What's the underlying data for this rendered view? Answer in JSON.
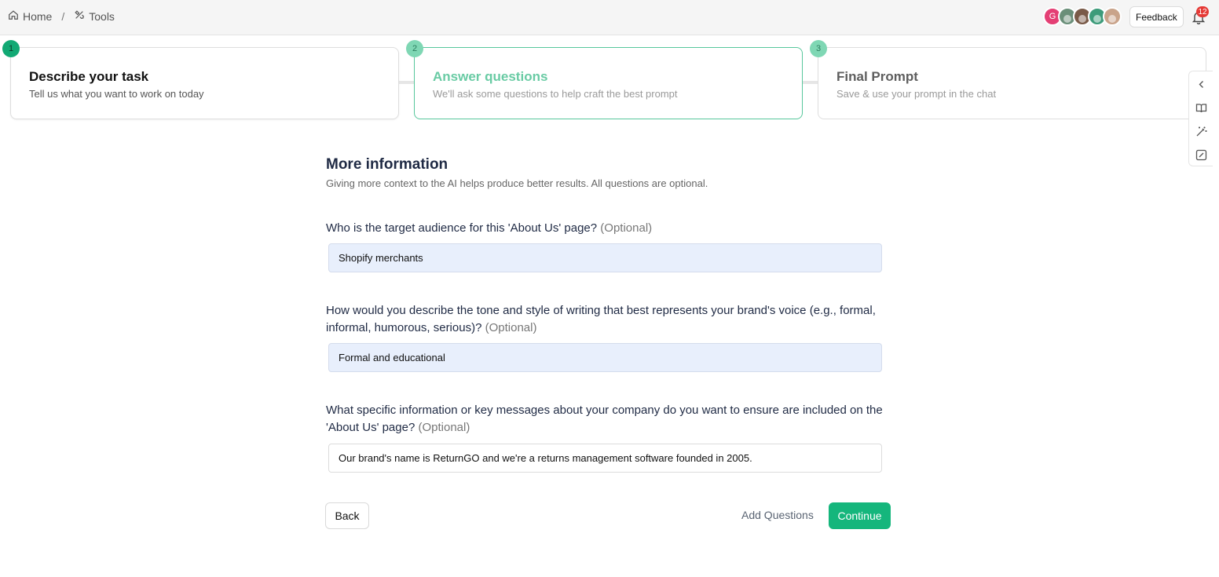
{
  "breadcrumb": {
    "home_label": "Home",
    "separator": "/",
    "tools_label": "Tools"
  },
  "header": {
    "avatars": [
      "G"
    ],
    "feedback_label": "Feedback",
    "notification_count": "12"
  },
  "steps": [
    {
      "number": "1",
      "title": "Describe your task",
      "subtitle": "Tell us what you want to work on today"
    },
    {
      "number": "2",
      "title": "Answer questions",
      "subtitle": "We'll ask some questions to help craft the best prompt"
    },
    {
      "number": "3",
      "title": "Final Prompt",
      "subtitle": "Save & use your prompt in the chat"
    }
  ],
  "form": {
    "title": "More information",
    "subtitle": "Giving more context to the AI helps produce better results. All questions are optional.",
    "optional_label": "(Optional)",
    "questions": [
      {
        "label": "Who is the target audience for this 'About Us' page?",
        "value": "Shopify merchants"
      },
      {
        "label": "How would you describe the tone and style of writing that best represents your brand's voice (e.g., formal, informal, humorous, serious)?",
        "value": "Formal and educational"
      },
      {
        "label": "What specific information or key messages about your company do you want to ensure are included on the 'About Us' page?",
        "value": "Our brand's name is ReturnGO and we're a returns management software founded in 2005."
      }
    ]
  },
  "actions": {
    "back_label": "Back",
    "add_questions_label": "Add Questions",
    "continue_label": "Continue"
  },
  "icons": {
    "home": "home-icon",
    "tools": "tools-icon",
    "bell": "bell-icon",
    "rail": [
      "chevron-left-icon",
      "book-icon",
      "magic-wand-icon",
      "edit-square-icon"
    ]
  },
  "colors": {
    "accent": "#15b67c",
    "step_active_border": "#58c79c",
    "input_fill": "#e8effc",
    "badge": "#e53935"
  }
}
